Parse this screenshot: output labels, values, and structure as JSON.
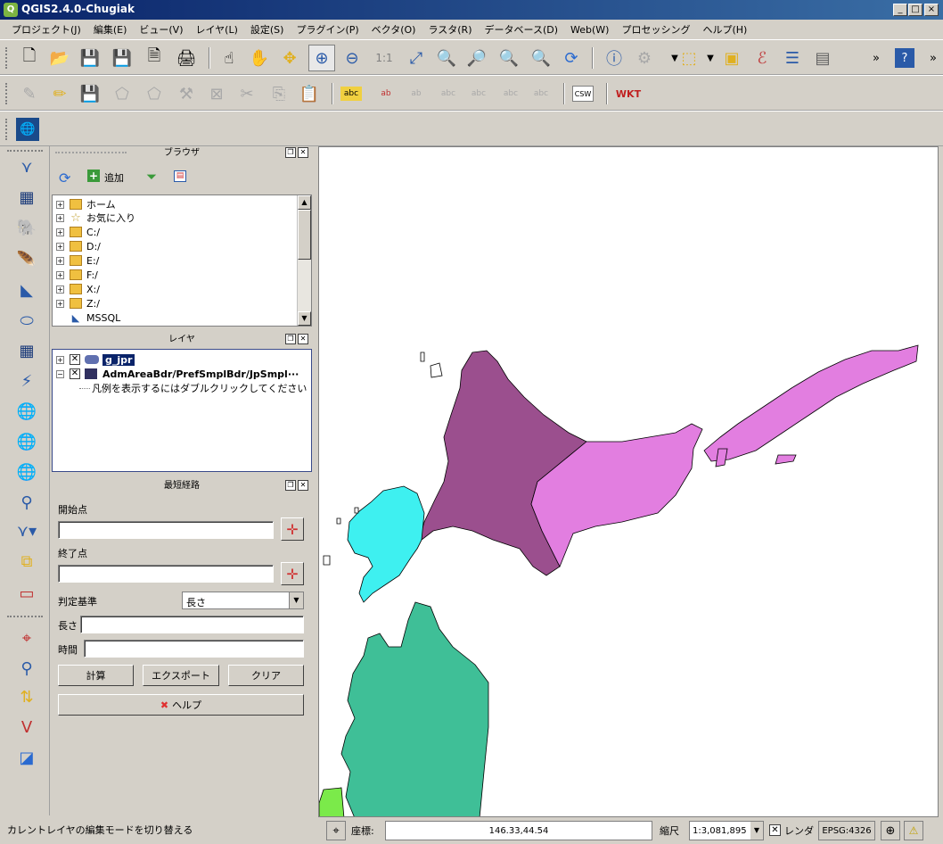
{
  "window": {
    "title": "QGIS2.4.0-Chugiak",
    "controls": [
      "_",
      "□",
      "×"
    ]
  },
  "menubar": [
    "プロジェクト(J)",
    "編集(E)",
    "ビュー(V)",
    "レイヤ(L)",
    "設定(S)",
    "プラグイン(P)",
    "ベクタ(O)",
    "ラスタ(R)",
    "データベース(D)",
    "Web(W)",
    "プロセッシング",
    "ヘルプ(H)"
  ],
  "toolbar1": {
    "icons": [
      "new-project",
      "open-project",
      "save-project",
      "save-as",
      "new-print-composer",
      "composer-manager",
      "touch-zoom",
      "pan",
      "pan-to-selection",
      "zoom-in",
      "zoom-out",
      "zoom-actual",
      "zoom-full",
      "zoom-to-selection",
      "zoom-to-layer",
      "zoom-last",
      "zoom-next",
      "refresh",
      "identify",
      "measure",
      "select-features",
      "deselect",
      "expression-select",
      "attribute-table",
      "field-calculator"
    ],
    "overflow": "»"
  },
  "toolbar2": {
    "icons": [
      "current-edits",
      "toggle-editing",
      "save-edits",
      "add-feature",
      "move-feature",
      "node-tool",
      "delete-selected",
      "cut-features",
      "copy-features",
      "paste-features",
      "label",
      "label-pin",
      "label-show-hide",
      "label-move",
      "label-rotate",
      "label-change",
      "label-edit",
      "csw",
      "wkt"
    ],
    "csw_label": "CSW",
    "wkt_label": "WKT"
  },
  "toolbar3": {
    "icons": [
      "google-earth"
    ]
  },
  "browser_panel": {
    "title": "ブラウザ",
    "refresh_icon": "refresh-icon",
    "add_label": "追加",
    "filter_icon": "filter-icon",
    "collapse_icon": "collapse-icon",
    "items": [
      {
        "label": "ホーム",
        "type": "folder"
      },
      {
        "label": "お気に入り",
        "type": "star"
      },
      {
        "label": "C:/",
        "type": "folder"
      },
      {
        "label": "D:/",
        "type": "folder"
      },
      {
        "label": "E:/",
        "type": "folder"
      },
      {
        "label": "F:/",
        "type": "folder"
      },
      {
        "label": "X:/",
        "type": "folder"
      },
      {
        "label": "Z:/",
        "type": "folder"
      },
      {
        "label": "MSSQL",
        "type": "mssql"
      }
    ]
  },
  "layers_panel": {
    "title": "レイヤ",
    "layers": [
      {
        "label": "g_jpr",
        "selected": true,
        "checked": true
      },
      {
        "label": "AdmAreaBdr/PrefSmplBdr/JpSmpl···",
        "selected": false,
        "checked": true
      }
    ],
    "legend_hint": "凡例を表示するにはダブルクリックしてください"
  },
  "shortest_path_panel": {
    "title": "最短経路",
    "start_label": "開始点",
    "start_value": "",
    "end_label": "終了点",
    "end_value": "",
    "criterion_label": "判定基準",
    "criterion_value": "長さ",
    "length_label": "長さ",
    "length_value": "",
    "time_label": "時間",
    "time_value": "",
    "calc_button": "計算",
    "export_button": "エクスポート",
    "clear_button": "クリア",
    "help_button": "ヘルプ"
  },
  "statusbar": {
    "message": "カレントレイヤの編集モードを切り替える",
    "coord_label": "座標:",
    "coord_value": "146.33,44.54",
    "scale_label": "縮尺",
    "scale_value": "1:3,081,895",
    "render_label": "レンダ",
    "crs": "EPSG:4326"
  },
  "map": {
    "colors": {
      "hokkaido_west": "#9b4f8e",
      "hokkaido_east": "#e27ee0",
      "hokkaido_south": "#3ef0f0",
      "aomori": "#3fbf97",
      "akita": "#7bea4a"
    }
  }
}
